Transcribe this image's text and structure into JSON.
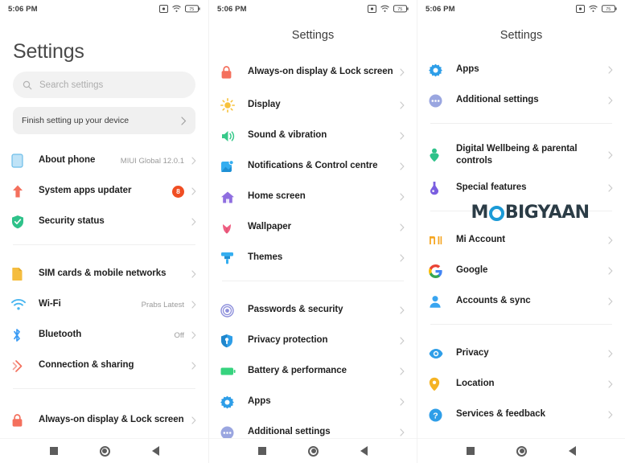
{
  "statusbar": {
    "time": "5:06 PM",
    "icons": [
      "screenshot-icon",
      "wifi-icon",
      "battery-icon"
    ],
    "battery_level": "75"
  },
  "watermark": {
    "text_before": "M",
    "circle": "O",
    "text_after": "BIGYAAN"
  },
  "navbar": {
    "recents": "recents-button",
    "home": "home-button",
    "back": "back-button"
  },
  "panel1": {
    "title": "Settings",
    "search": {
      "placeholder": "Search settings",
      "icon": "search-icon"
    },
    "promo": {
      "label": "Finish setting up your device"
    },
    "groups": [
      {
        "items": [
          {
            "label": "About phone",
            "value": "MIUI Global 12.0.1",
            "icon": "phone-icon",
            "color": "#8ecdf0"
          },
          {
            "label": "System apps updater",
            "badge": "8",
            "icon": "up-arrow-icon",
            "color": "#f4705d"
          },
          {
            "label": "Security status",
            "icon": "shield-check-icon",
            "color": "#2fc28a"
          }
        ]
      },
      {
        "items": [
          {
            "label": "SIM cards & mobile networks",
            "icon": "sim-card-icon",
            "color": "#f5bd3f"
          },
          {
            "label": "Wi-Fi",
            "value": "Prabs Latest",
            "icon": "wifi-icon",
            "color": "#49b6f0"
          },
          {
            "label": "Bluetooth",
            "value": "Off",
            "icon": "bluetooth-icon",
            "color": "#3a9bf4"
          },
          {
            "label": "Connection & sharing",
            "icon": "connection-sharing-icon",
            "color": "#f4705d"
          }
        ]
      },
      {
        "items": [
          {
            "label": "Always-on display & Lock screen",
            "icon": "lock-icon",
            "color": "#f4705d"
          }
        ]
      }
    ]
  },
  "panel2": {
    "title": "Settings",
    "groups": [
      {
        "items": [
          {
            "label": "Always-on display & Lock screen",
            "icon": "lock-icon",
            "color": "#f4705d"
          },
          {
            "label": "Display",
            "icon": "brightness-icon",
            "color": "#f7c23c"
          },
          {
            "label": "Sound & vibration",
            "icon": "speaker-icon",
            "color": "#37c98a"
          },
          {
            "label": "Notifications & Control centre",
            "icon": "notifications-icon",
            "color": "#35aef0"
          },
          {
            "label": "Home screen",
            "icon": "home-icon",
            "color": "#8f6ee0"
          },
          {
            "label": "Wallpaper",
            "icon": "flower-icon",
            "color": "#ef5f82"
          },
          {
            "label": "Themes",
            "icon": "paintbrush-icon",
            "color": "#35aef0"
          }
        ]
      },
      {
        "items": [
          {
            "label": "Passwords & security",
            "icon": "fingerprint-icon",
            "color": "#8d8fdb"
          },
          {
            "label": "Privacy protection",
            "icon": "privacy-shield-icon",
            "color": "#2e9ee8"
          },
          {
            "label": "Battery & performance",
            "icon": "battery-icon",
            "color": "#36d37e"
          },
          {
            "label": "Apps",
            "icon": "gear-icon",
            "color": "#2e9ee8"
          },
          {
            "label": "Additional settings",
            "icon": "dots-icon",
            "color": "#9aa6e0"
          }
        ]
      }
    ]
  },
  "panel3": {
    "title": "Settings",
    "groups": [
      {
        "items": [
          {
            "label": "Apps",
            "icon": "gear-icon",
            "color": "#2e9ee8"
          },
          {
            "label": "Additional settings",
            "icon": "dots-icon",
            "color": "#9aa6e0"
          }
        ]
      },
      {
        "items": [
          {
            "label": "Digital Wellbeing & parental controls",
            "icon": "wellbeing-icon",
            "color": "#2fc28a"
          },
          {
            "label": "Special features",
            "icon": "flask-icon",
            "color": "#7a5ee0"
          }
        ]
      },
      {
        "items": [
          {
            "label": "Mi Account",
            "icon": "mi-logo-icon",
            "color": "#f5a623"
          },
          {
            "label": "Google",
            "icon": "google-icon",
            "color": "#4285f4"
          },
          {
            "label": "Accounts & sync",
            "icon": "person-icon",
            "color": "#39a5f0"
          }
        ]
      },
      {
        "items": [
          {
            "label": "Privacy",
            "icon": "eye-icon",
            "color": "#2e9ee8"
          },
          {
            "label": "Location",
            "icon": "location-pin-icon",
            "color": "#f5b323"
          },
          {
            "label": "Services & feedback",
            "icon": "question-mark-icon",
            "color": "#2e9ee8"
          }
        ]
      }
    ]
  }
}
